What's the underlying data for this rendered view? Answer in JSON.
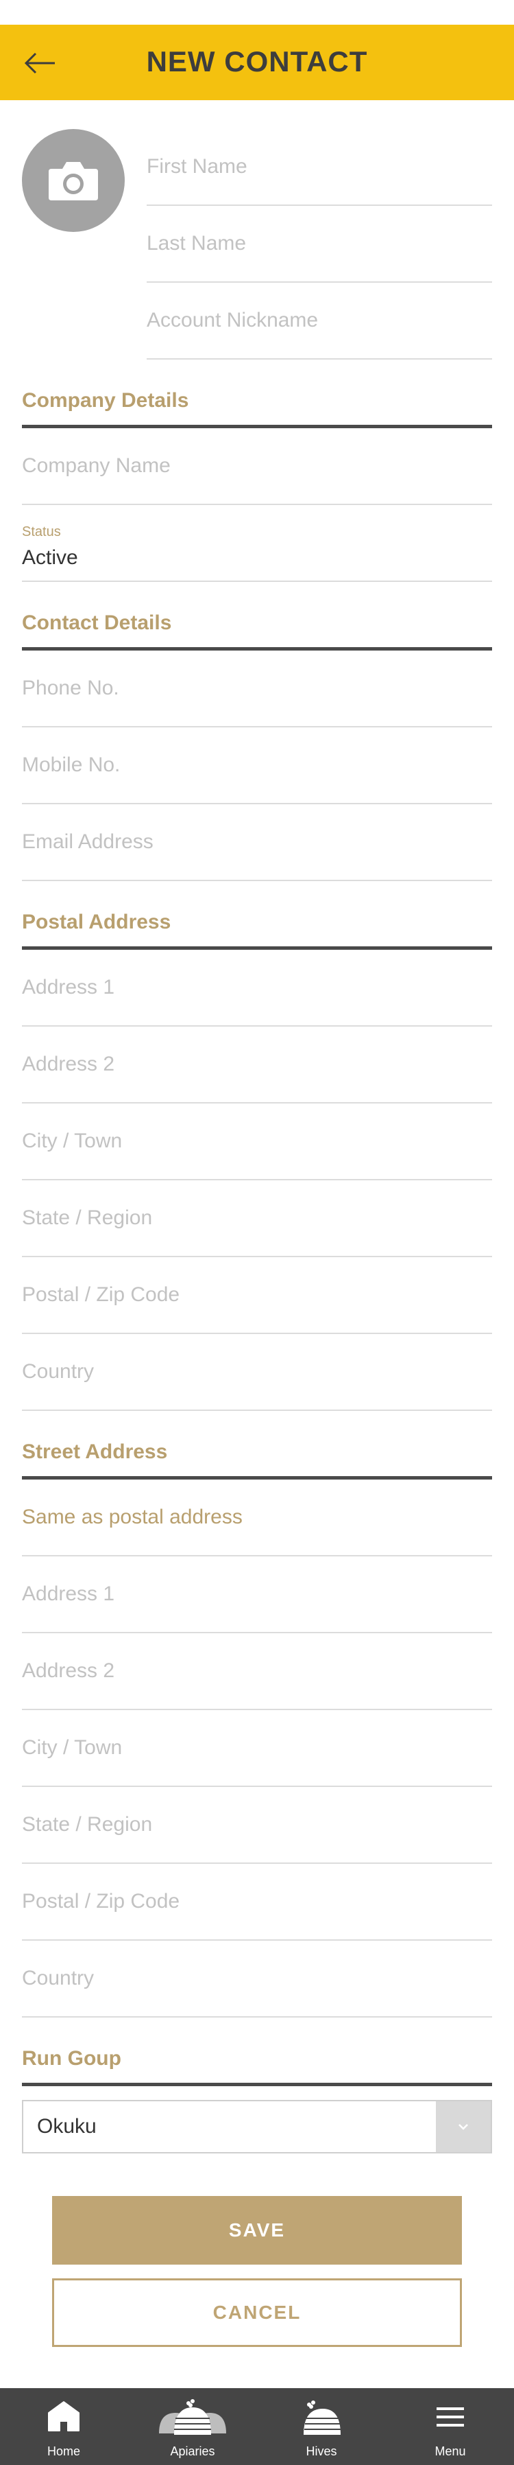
{
  "header": {
    "title": "NEW CONTACT",
    "background": "#f4c10f"
  },
  "name": {
    "first_name_placeholder": "First Name",
    "last_name_placeholder": "Last Name",
    "nickname_placeholder": "Account Nickname"
  },
  "company": {
    "heading": "Company Details",
    "company_name_placeholder": "Company Name",
    "status_label": "Status",
    "status_value": "Active"
  },
  "contact": {
    "heading": "Contact Details",
    "phone_placeholder": "Phone No.",
    "mobile_placeholder": "Mobile No.",
    "email_placeholder": "Email Address"
  },
  "postal": {
    "heading": "Postal Address",
    "address1": "Address 1",
    "address2": "Address 2",
    "city": "City / Town",
    "state": "State / Region",
    "zip": "Postal / Zip Code",
    "country": "Country"
  },
  "street": {
    "heading": "Street Address",
    "same_as_postal": "Same as postal address",
    "address1": "Address 1",
    "address2": "Address 2",
    "city": "City / Town",
    "state": "State / Region",
    "zip": "Postal / Zip Code",
    "country": "Country"
  },
  "run_group": {
    "heading": "Run Goup",
    "selected": "Okuku"
  },
  "actions": {
    "save": "SAVE",
    "cancel": "CANCEL"
  },
  "bottom_nav": [
    {
      "label": "Home",
      "icon": "home-icon"
    },
    {
      "label": "Apiaries",
      "icon": "apiaries-icon"
    },
    {
      "label": "Hives",
      "icon": "hive-icon"
    },
    {
      "label": "Menu",
      "icon": "menu-icon"
    }
  ],
  "colors": {
    "accent": "#bfa574",
    "header": "#f4c10f",
    "nav": "#454545",
    "divider": "#4a4a4a"
  }
}
